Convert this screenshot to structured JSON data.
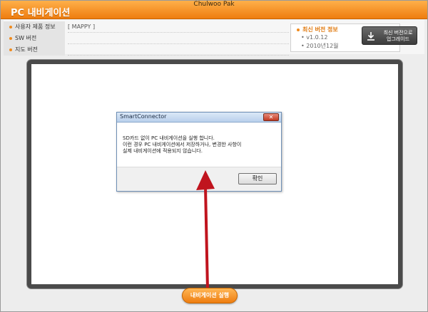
{
  "window": {
    "author": "Chulwoo Pak",
    "title": "PC 내비게이션"
  },
  "info": {
    "rows": [
      {
        "label": "사용자 제품 정보",
        "value": "[ MAPPY ]"
      },
      {
        "label": "SW 버전",
        "value": ""
      },
      {
        "label": "지도 버전",
        "value": ""
      }
    ]
  },
  "update": {
    "title": "최신 버전 정보",
    "version": "• v1.0.12",
    "date": "• 2010년12월",
    "button_label_line1": "최신 버전으로",
    "button_label_line2": "업그레이드"
  },
  "dialog": {
    "title": "SmartConnector",
    "close_label": "✕",
    "message_lines": [
      "SD카드 없이 PC 내비게이션을 실행 합니다.",
      "이런 경우 PC 내비게이션에서 저장하거나, 변경한 사항이",
      "실제 내비게이션에 적용되지 않습니다."
    ],
    "ok_label": "확인"
  },
  "run_button_label": "내비게이션 실행",
  "colors": {
    "accent_orange": "#ee7d10",
    "arrow_red": "#c0141e"
  }
}
